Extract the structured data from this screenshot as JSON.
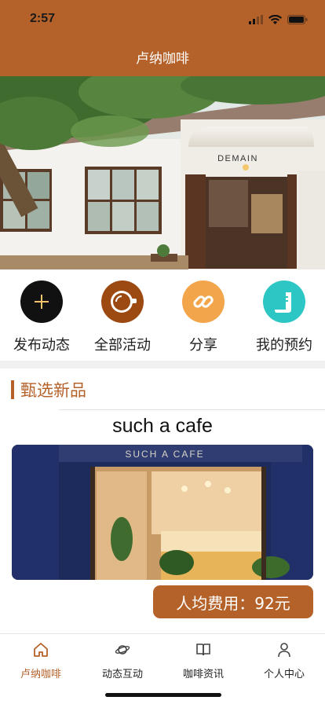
{
  "status": {
    "time": "2:57"
  },
  "header": {
    "title": "卢纳咖啡"
  },
  "hero": {
    "sign_text": "DEMAIN"
  },
  "quick_actions": [
    {
      "label": "发布动态",
      "icon": "plus-icon",
      "color": "#111111"
    },
    {
      "label": "全部活动",
      "icon": "coffee-cup-icon",
      "color": "#9c4a12"
    },
    {
      "label": "分享",
      "icon": "link-icon",
      "color": "#f2a54a"
    },
    {
      "label": "我的预约",
      "icon": "scroll-icon",
      "color": "#2cc6c4"
    }
  ],
  "section": {
    "title": "甄选新品"
  },
  "product": {
    "name": "such a cafe",
    "sign_text": "SUCH A CAFE",
    "price_label": "人均费用：92元"
  },
  "tabbar": {
    "items": [
      {
        "label": "卢纳咖啡",
        "icon": "home-icon",
        "active": true
      },
      {
        "label": "动态互动",
        "icon": "planet-icon",
        "active": false
      },
      {
        "label": "咖啡资讯",
        "icon": "book-icon",
        "active": false
      },
      {
        "label": "个人中心",
        "icon": "person-icon",
        "active": false
      }
    ]
  },
  "colors": {
    "brand": "#b5622a"
  }
}
